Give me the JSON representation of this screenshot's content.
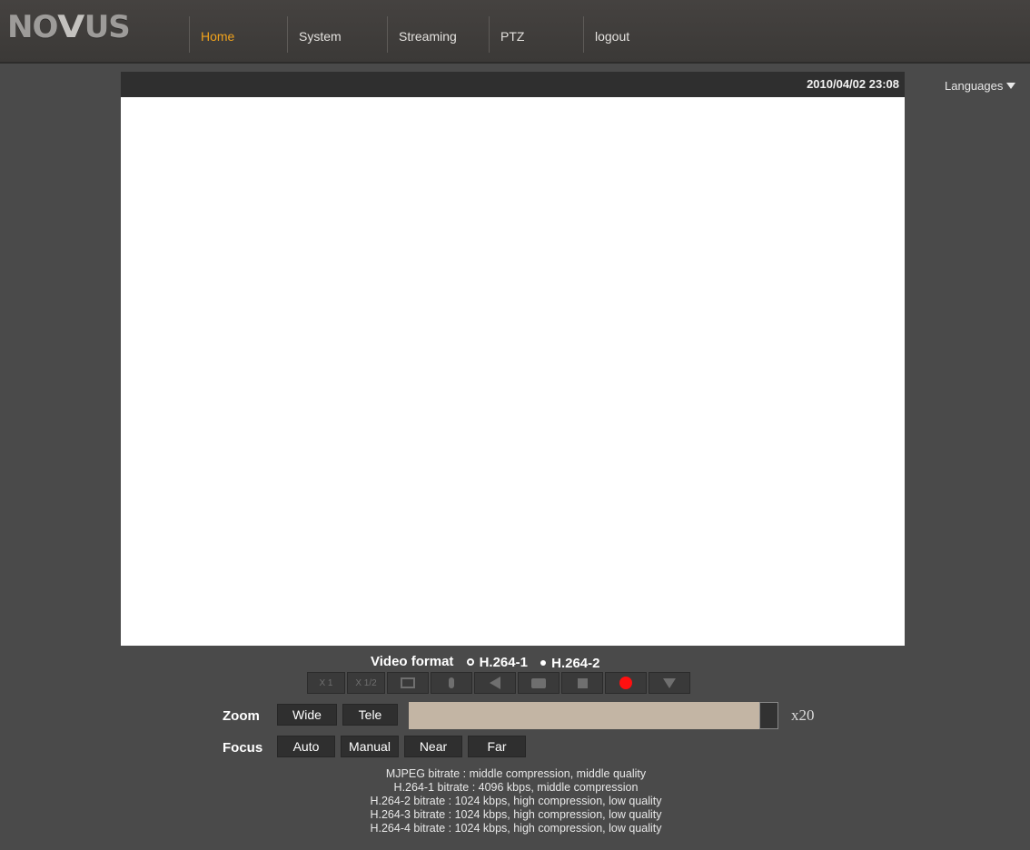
{
  "brand": {
    "logo_prefix": "NO",
    "logo_v": "V",
    "logo_suffix": "US"
  },
  "nav": {
    "home": "Home",
    "system": "System",
    "streaming": "Streaming",
    "ptz": "PTZ",
    "logout": "logout"
  },
  "video": {
    "timestamp": "2010/04/02 23:08"
  },
  "languages": {
    "label": "Languages"
  },
  "video_format": {
    "label": "Video format",
    "options": [
      "H.264-1",
      "H.264-2"
    ],
    "selected": "H.264-1"
  },
  "toolbar": {
    "x1": "X 1",
    "x_half": "X 1/2"
  },
  "zoom": {
    "label": "Zoom",
    "wide": "Wide",
    "tele": "Tele",
    "level": "x20"
  },
  "focus": {
    "label": "Focus",
    "auto": "Auto",
    "manual": "Manual",
    "near": "Near",
    "far": "Far"
  },
  "bitrates": [
    "MJPEG bitrate : middle compression, middle quality",
    "H.264-1 bitrate : 4096 kbps, middle compression",
    "H.264-2 bitrate : 1024 kbps, high compression, low quality",
    "H.264-3 bitrate : 1024 kbps, high compression, low quality",
    "H.264-4 bitrate : 1024 kbps, high compression, low quality"
  ],
  "colors": {
    "background": "#4a4a4a",
    "nav_active": "#f0a21c",
    "zoom_bar": "#c3b5a4",
    "record": "#ff1010"
  }
}
